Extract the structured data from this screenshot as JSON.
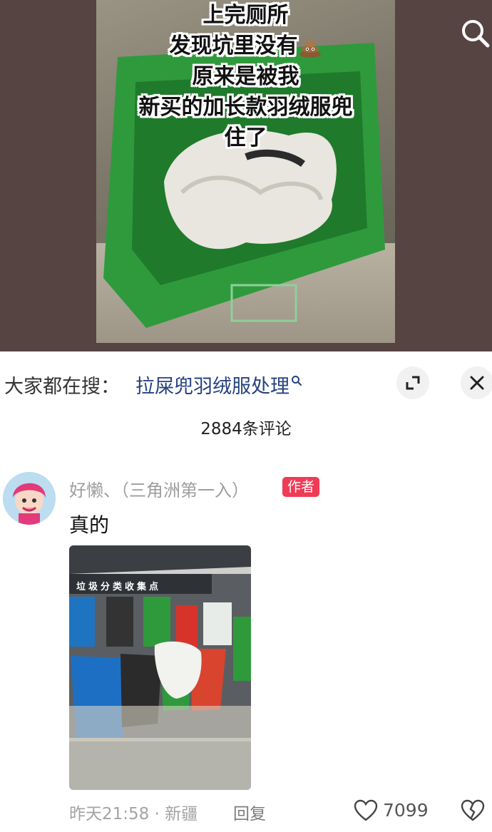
{
  "video": {
    "caption_lines": [
      "上完厕所",
      "发现坑里没有",
      "原来是被我",
      "新买的加长款羽绒服兜",
      "住了"
    ],
    "caption_icon": "poop-emoji-icon",
    "search_icon": "search-icon"
  },
  "trending": {
    "label": "大家都在搜：",
    "query": "拉屎兜羽绒服处理",
    "query_icon": "search-icon",
    "expand_icon": "expand-icon",
    "close_icon": "close-icon"
  },
  "comments_header": {
    "count_text": "2884条评论"
  },
  "comment": {
    "username": "好懒、（三角洲第一入）",
    "author_badge": "作者",
    "text": "真的",
    "photo_sign_text": "垃圾分类收集点",
    "time": "昨天21:58",
    "separator": "·",
    "location": "新疆",
    "reply_label": "回复",
    "like_count": "7099",
    "like_icon": "heart-outline-icon",
    "dislike_icon": "broken-heart-icon"
  },
  "colors": {
    "video_background": "#564442",
    "trend_link": "#26427e",
    "author_badge": "#f03b57",
    "bin_green": "#2f9a3c"
  }
}
